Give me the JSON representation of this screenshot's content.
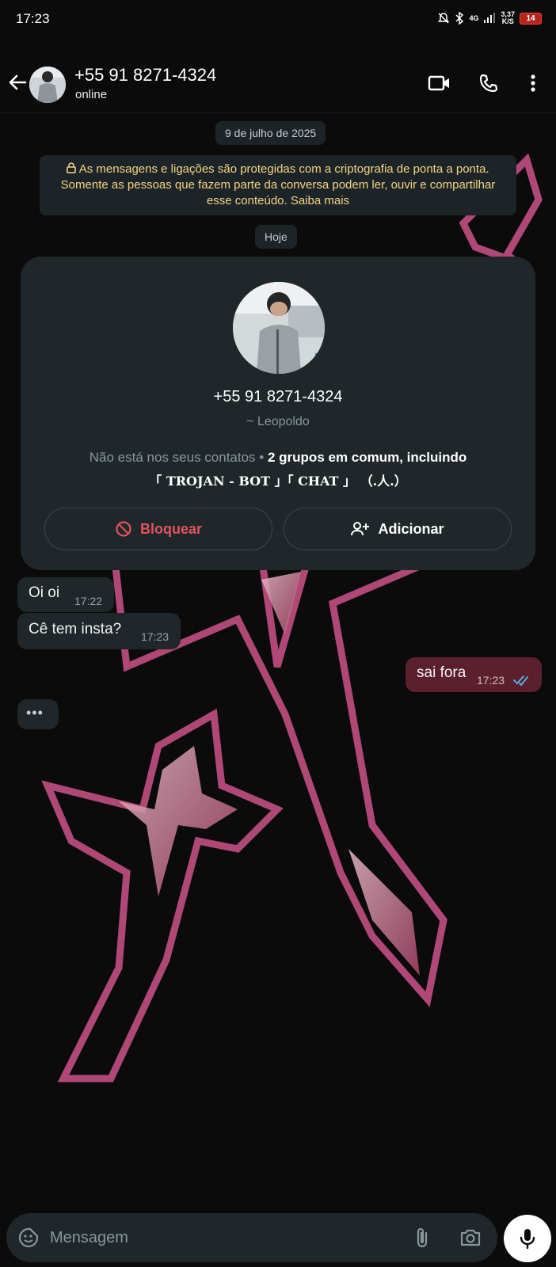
{
  "status_bar": {
    "time": "17:23",
    "network_type": "4G",
    "speed_value": "3,37",
    "speed_unit": "K/S",
    "battery": "14"
  },
  "header": {
    "title": "+55 91 8271-4324",
    "status": "online"
  },
  "chat": {
    "date_chip": "9 de julho de 2025",
    "encryption_notice": "As mensagens e ligações são protegidas com a criptografia de ponta a ponta. Somente as pessoas que fazem parte da conversa podem ler, ouvir e compartilhar esse conteúdo. Saiba mais",
    "today_chip": "Hoje",
    "contact_card": {
      "phone": "+55 91 8271-4324",
      "nickname": "~ Leopoldo",
      "not_in_contacts": "Não está nos seus contatos",
      "separator": "•",
      "groups_in_common": "2 grupos em comum, incluindo",
      "groups": "「 TROJAN - BOT 」「 CHAT 」 （.人.）",
      "block_label": "Bloquear",
      "add_label": "Adicionar"
    },
    "messages": [
      {
        "direction": "in",
        "text": "Oi oi",
        "time": "17:22"
      },
      {
        "direction": "in",
        "text": "Cê tem insta?",
        "time": "17:23"
      },
      {
        "direction": "out",
        "text": "sai fora",
        "time": "17:23",
        "status": "read"
      }
    ],
    "typing_indicator": "•••"
  },
  "input_bar": {
    "placeholder": "Mensagem"
  },
  "colors": {
    "accent_red": "#e0535f",
    "read_tick": "#53bdeb",
    "outgoing_bubble": "#5b1f2d",
    "incoming_bubble": "#1f272b"
  }
}
